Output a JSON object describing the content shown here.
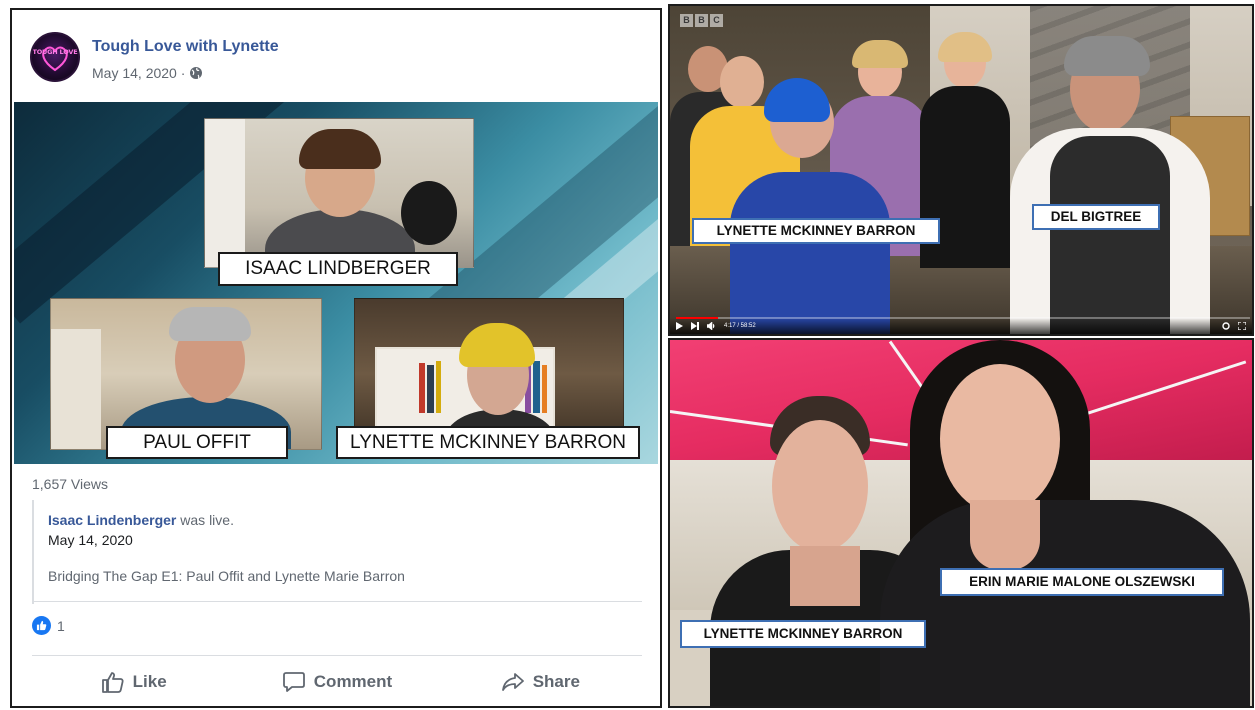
{
  "facebook_post": {
    "page_name": "Tough Love with Lynette",
    "post_date": "May 14, 2020 ·",
    "avatar_logo_text": "TOUGH LOVE",
    "video": {
      "captions": {
        "isaac": "ISAAC LINDBERGER",
        "paul": "PAUL OFFIT",
        "lynette": "LYNETTE MCKINNEY BARRON"
      }
    },
    "views": "1,657 Views",
    "shared_live": {
      "name": "Isaac Lindenberger",
      "was_live": " was live.",
      "date": "May 14, 2020",
      "title": "Bridging The Gap E1: Paul Offit and Lynette Marie Barron"
    },
    "reactions": {
      "count": "1"
    },
    "actions": {
      "like": "Like",
      "comment": "Comment",
      "share": "Share"
    }
  },
  "video_screenshot": {
    "labels": {
      "lynette": "LYNETTE MCKINNEY BARRON",
      "del": "DEL BIGTREE"
    },
    "logo": [
      "B",
      "B",
      "C"
    ],
    "time": "4:17 / 58:52",
    "progress_fraction": 0.073
  },
  "photo": {
    "labels": {
      "erin": "ERIN MARIE MALONE OLSZEWSKI",
      "lynette": "LYNETTE MCKINNEY BARRON"
    }
  },
  "colors": {
    "facebook_link": "#385898",
    "facebook_blue": "#1877f2",
    "label_border": "#3e6fb3",
    "canopy_pink": "#e52c61"
  },
  "icons": [
    "globe-icon",
    "like-reaction-icon",
    "thumbs-up-icon",
    "comment-icon",
    "share-icon",
    "play-icon",
    "next-icon",
    "volume-icon",
    "settings-icon",
    "fullscreen-icon"
  ]
}
